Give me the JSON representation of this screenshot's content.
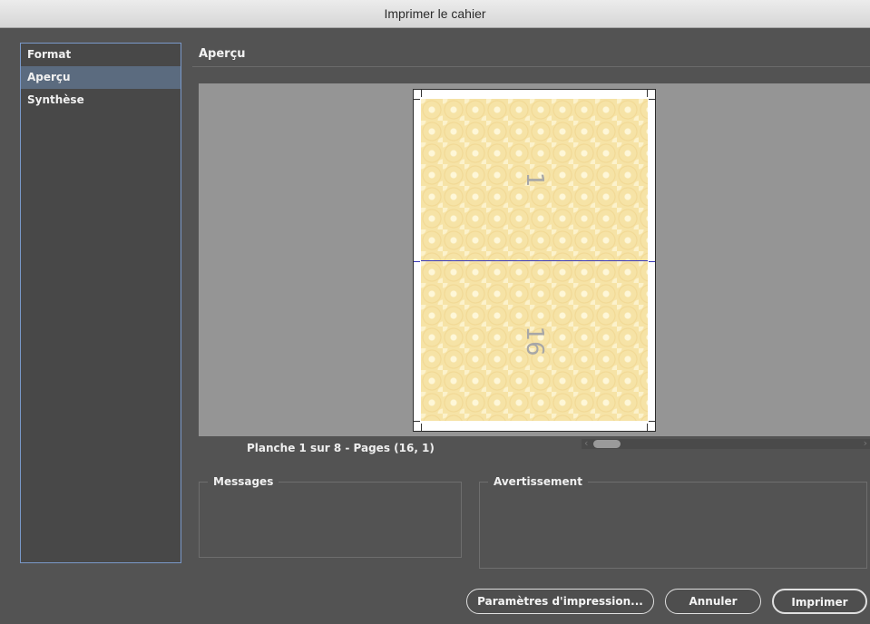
{
  "window": {
    "title": "Imprimer le cahier"
  },
  "sidebar": {
    "items": [
      {
        "label": "Format",
        "selected": false
      },
      {
        "label": "Aperçu",
        "selected": true
      },
      {
        "label": "Synthèse",
        "selected": false
      }
    ]
  },
  "main": {
    "section_title": "Aperçu",
    "preview": {
      "pages": [
        {
          "number": "1"
        },
        {
          "number": "16"
        }
      ],
      "sheet_info": "Planche 1 sur 8 - Pages (16, 1)"
    },
    "messages": {
      "label": "Messages"
    },
    "warning": {
      "label": "Avertissement"
    }
  },
  "buttons": {
    "print_settings": "Paramètres d'impression...",
    "cancel": "Annuler",
    "print": "Imprimer"
  },
  "colors": {
    "background": "#535353",
    "sidebar_selection": "#5b6b7f",
    "sidebar_border": "#7a99c9",
    "preview_background": "#959595",
    "page_fill": "#f6e3a6",
    "page_divider": "#3a3ab8"
  },
  "icons": {
    "scroll_left": "chevron-left-icon",
    "scroll_right": "chevron-right-icon"
  }
}
